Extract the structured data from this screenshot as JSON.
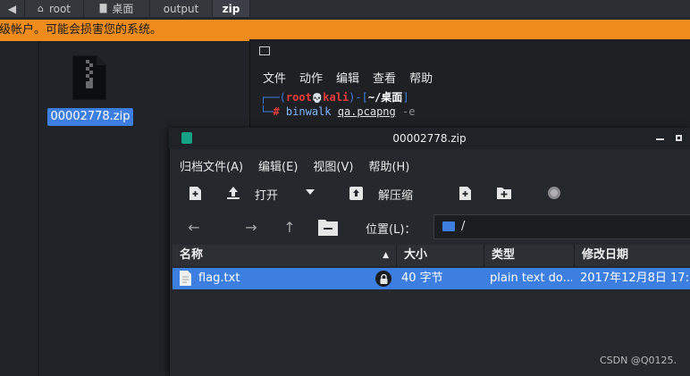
{
  "breadcrumb": {
    "items": [
      {
        "label": "root"
      },
      {
        "label": "桌面"
      },
      {
        "label": "output"
      },
      {
        "label": "zip"
      }
    ]
  },
  "warning": {
    "text": "超级帐户。可能会损害您的系统。"
  },
  "desktop": {
    "file_label": "00002778.zip"
  },
  "terminal": {
    "menu": [
      "文件",
      "动作",
      "编辑",
      "查看",
      "帮助"
    ],
    "line1_user": "root",
    "line1_skull": "💀",
    "line1_host": "kali",
    "line1_path": "~/桌面",
    "line2_cmd": "binwalk",
    "line2_arg": "qa.pcapng",
    "line2_flag": "-e"
  },
  "archive": {
    "title": "00002778.zip",
    "menu": [
      "归档文件(A)",
      "编辑(E)",
      "视图(V)",
      "帮助(H)"
    ],
    "toolbar": {
      "open": "打开",
      "extract": "解压缩"
    },
    "location_label": "位置(L)：",
    "location_value": "/",
    "columns": [
      "名称",
      "大小",
      "类型",
      "修改日期"
    ],
    "rows": [
      {
        "name": "flag.txt",
        "size": "40 字节",
        "type": "plain text do...",
        "date": "2017年12月8日 17:"
      }
    ]
  },
  "watermark": "CSDN @Q0125.",
  "colors": {
    "accent": "#3d7fe0",
    "warning": "#f08c1d",
    "prompt": "#3d7fe0",
    "root_red": "#e83b3b"
  }
}
